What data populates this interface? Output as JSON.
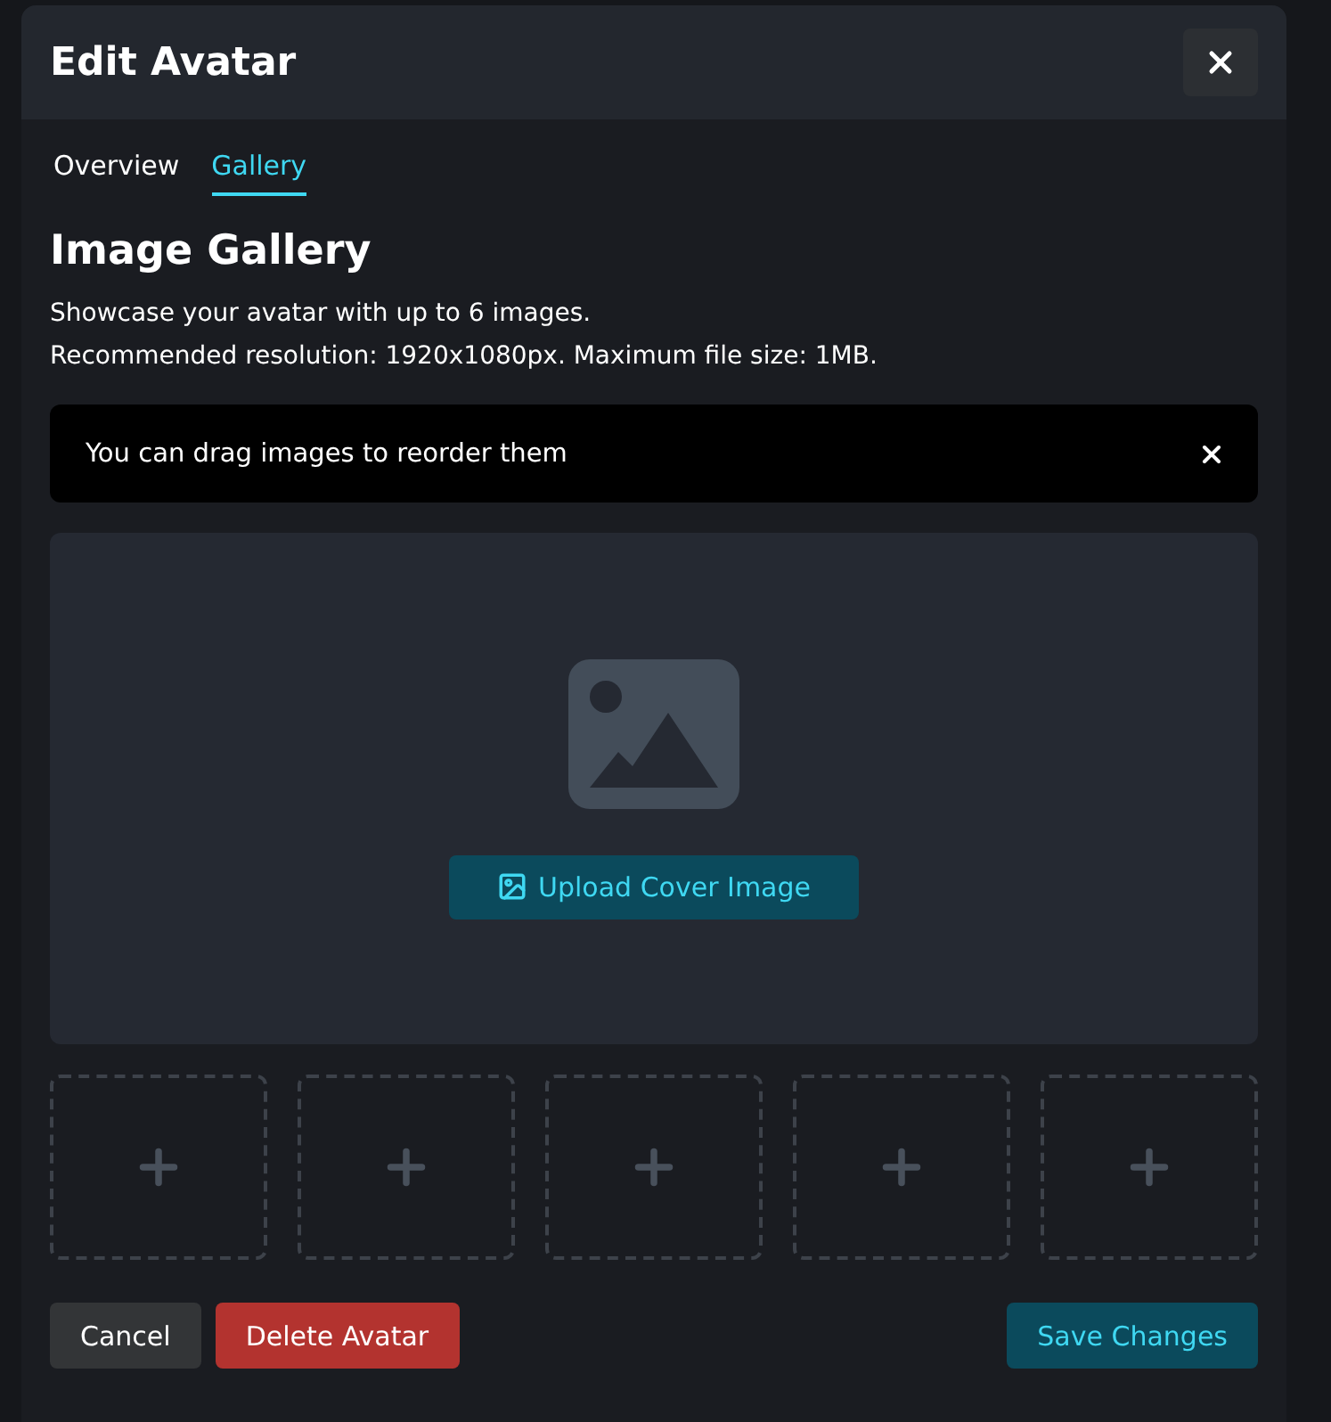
{
  "dialog": {
    "title": "Edit Avatar"
  },
  "tabs": [
    {
      "label": "Overview",
      "selected": false
    },
    {
      "label": "Gallery",
      "selected": true
    }
  ],
  "section": {
    "heading": "Image Gallery",
    "lines": [
      "Showcase your avatar with up to 6 images.",
      "Recommended resolution: 1920x1080px. Maximum file size: 1MB."
    ]
  },
  "notice": {
    "text": "You can drag images to reorder them"
  },
  "cover": {
    "upload_label": "Upload Cover Image"
  },
  "slots": [
    {
      "kind": "empty"
    },
    {
      "kind": "empty"
    },
    {
      "kind": "empty"
    },
    {
      "kind": "empty"
    },
    {
      "kind": "empty"
    }
  ],
  "buttons": [
    {
      "label": "Cancel",
      "kind": "neutral"
    },
    {
      "label": "Delete Avatar",
      "kind": "danger"
    },
    {
      "label": "Save Changes",
      "kind": "primary"
    }
  ]
}
